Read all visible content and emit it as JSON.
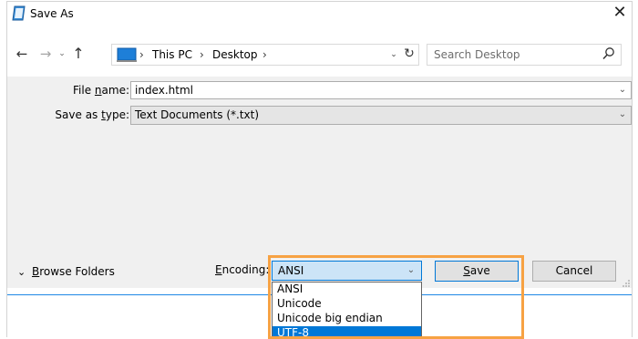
{
  "window": {
    "title": "Save As",
    "close_glyph": "✕",
    "app_icon": "notepad-icon"
  },
  "nav": {
    "back_glyph": "←",
    "forward_glyph": "→",
    "recent_glyph": "⌄",
    "up_glyph": "↑",
    "breadcrumb": [
      "This PC",
      "Desktop"
    ],
    "separator": "›",
    "address_dropdown_glyph": "⌄",
    "refresh_glyph": "↻",
    "search_placeholder": "Search Desktop"
  },
  "form": {
    "file_name_label_pre": "File ",
    "file_name_label_u": "n",
    "file_name_label_post": "ame:",
    "file_name_value": "index.html",
    "save_type_label_pre": "Save as ",
    "save_type_label_u": "t",
    "save_type_label_post": "ype:",
    "save_type_value": "Text Documents (*.txt)",
    "dropdown_glyph": "⌄"
  },
  "footer": {
    "browse_glyph": "⌄",
    "browse_label_u": "B",
    "browse_label_post": "rowse Folders",
    "encoding_label_u": "E",
    "encoding_label_post": "ncoding:",
    "encoding_value": "ANSI",
    "encoding_options": [
      "ANSI",
      "Unicode",
      "Unicode big endian",
      "UTF-8"
    ],
    "encoding_selected_index": 3,
    "save_label_u": "S",
    "save_label_post": "ave",
    "cancel_label": "Cancel"
  },
  "colors": {
    "accent": "#0078d7",
    "highlight": "#f7a243",
    "form_bg": "#f0f0f0"
  }
}
